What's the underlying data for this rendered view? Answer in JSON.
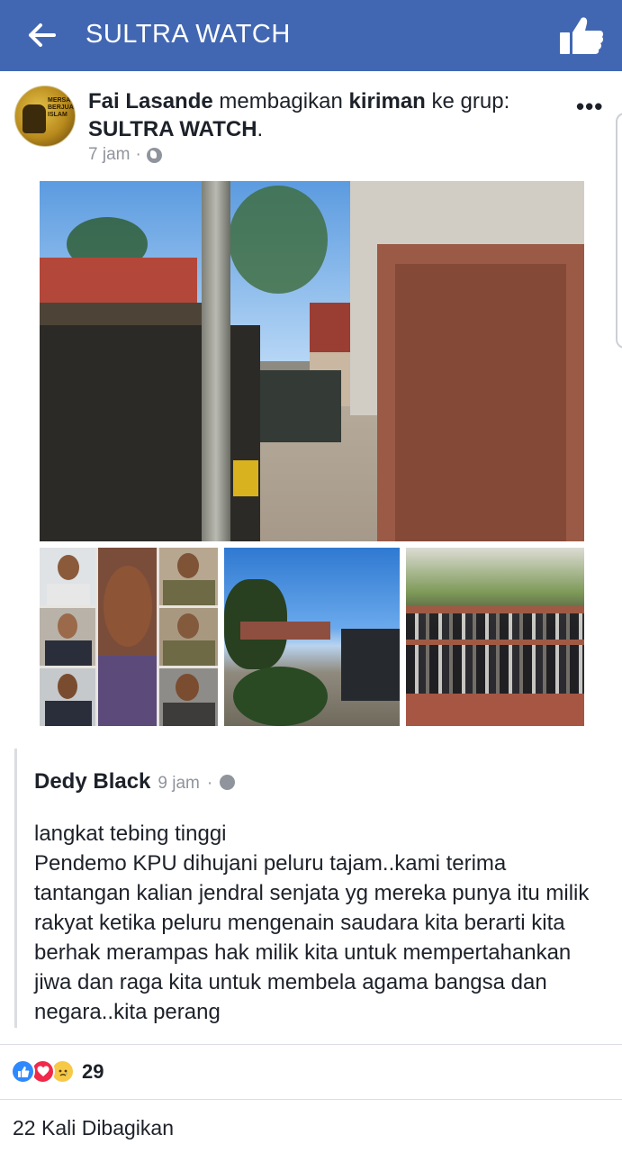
{
  "appbar": {
    "title": "SULTRA WATCH",
    "color": "#4267b2",
    "back_icon": "back-arrow-icon",
    "action_icon": "thumbs-up-icon"
  },
  "post": {
    "author": "Fai Lasande",
    "action_text": " membagikan ",
    "object_text": "kiriman",
    "to_text": " ke grup: ",
    "group": "SULTRA WATCH",
    "period": ".",
    "time": "7 jam",
    "separator": "·",
    "privacy_icon": "globe-icon",
    "more_label": "•••",
    "avatar_text": "MERSATU BERJUANG ISLAM"
  },
  "shared": {
    "author": "Dedy Black",
    "time": "9 jam",
    "separator": "·",
    "body": "langkat tebing tinggi\nPendemo KPU dihujani peluru tajam..kami terima tantangan kalian jendral senjata yg mereka punya itu milik rakyat ketika peluru mengenain saudara kita berarti kita berhak merampas hak milik kita untuk mempertahankan jiwa dan raga kita untuk membela agama bangsa dan negara..kita perang"
  },
  "engagement": {
    "reaction_icons": [
      "like-icon",
      "love-icon",
      "sad-icon"
    ],
    "reaction_count": "29",
    "shares": "22 Kali Dibagikan"
  }
}
